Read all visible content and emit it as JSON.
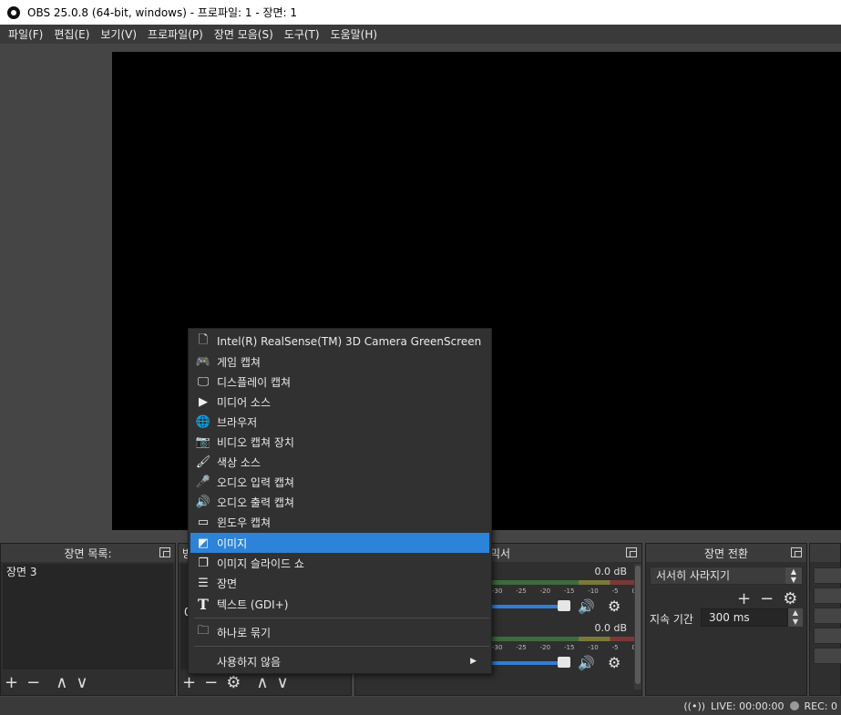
{
  "window": {
    "title": "OBS 25.0.8 (64-bit, windows) - 프로파일: 1 - 장면: 1"
  },
  "menu": [
    "파일(F)",
    "편집(E)",
    "보기(V)",
    "프로파일(P)",
    "장면 모음(S)",
    "도구(T)",
    "도움말(H)"
  ],
  "scenes": {
    "title": "장면 목록:",
    "items": [
      "장면 3"
    ]
  },
  "sources": {
    "title_fragment": "방",
    "value_fragment": "0"
  },
  "mixer": {
    "title_fragment": "믹서",
    "channels": [
      {
        "db": "0.0 dB"
      },
      {
        "db": "0.0 dB"
      }
    ],
    "ticks": [
      "-30",
      "-25",
      "-20",
      "-15",
      "-10",
      "-5",
      "0"
    ]
  },
  "transitions": {
    "title": "장면 전환",
    "selected": "서서히 사라지기",
    "duration_label": "지속 기간",
    "duration_value": "300 ms"
  },
  "status": {
    "live": "LIVE: 00:00:00",
    "rec": "REC: 0"
  },
  "context_menu": {
    "items": [
      {
        "label": "Intel(R) RealSense(TM) 3D Camera GreenScreen",
        "icon": "page-icon"
      },
      {
        "label": "게임 캡쳐",
        "icon": "gamepad-icon"
      },
      {
        "label": "디스플레이 캡쳐",
        "icon": "monitor-icon"
      },
      {
        "label": "미디어 소스",
        "icon": "play-icon"
      },
      {
        "label": "브라우저",
        "icon": "globe-icon"
      },
      {
        "label": "비디오 캡쳐 장치",
        "icon": "camera-icon"
      },
      {
        "label": "색상 소스",
        "icon": "brush-icon"
      },
      {
        "label": "오디오 입력 캡쳐",
        "icon": "microphone-icon"
      },
      {
        "label": "오디오 출력 캡쳐",
        "icon": "speaker-icon"
      },
      {
        "label": "윈도우 캡쳐",
        "icon": "window-icon"
      },
      {
        "label": "이미지",
        "icon": "image-icon"
      },
      {
        "label": "이미지 슬라이드 쇼",
        "icon": "slideshow-icon"
      },
      {
        "label": "장면",
        "icon": "list-icon"
      },
      {
        "label": "텍스트 (GDI+)",
        "icon": "text-icon"
      }
    ],
    "group": {
      "label": "하나로 묶기",
      "icon": "folder-icon"
    },
    "deprecated": {
      "label": "사용하지 않음"
    },
    "selected_index": 10,
    "accent": "#2c83d8"
  }
}
